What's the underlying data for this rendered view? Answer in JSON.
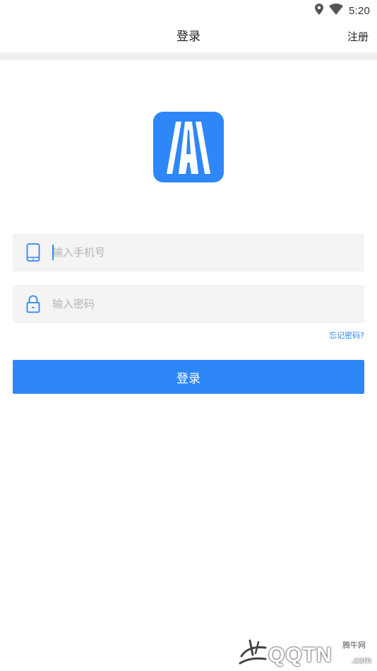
{
  "status_bar": {
    "time": "5:20",
    "icons": [
      "location-icon",
      "wifi-icon"
    ]
  },
  "nav": {
    "title": "登录",
    "register_label": "注册"
  },
  "logo": {
    "icon": "app-logo-a-icon",
    "color": "#2e87f8"
  },
  "form": {
    "phone": {
      "icon": "phone-icon",
      "value": "",
      "placeholder": "输入手机号"
    },
    "password": {
      "icon": "lock-icon",
      "value": "",
      "placeholder": "输入密码"
    },
    "forgot_label": "忘记密码?",
    "submit_label": "登录"
  },
  "watermark": {
    "small_text": "腾牛网",
    "big_text": "QQTN",
    "suffix": ".com"
  },
  "colors": {
    "accent": "#2e87f8",
    "field_bg": "#f4f4f4",
    "divider": "#efefef"
  }
}
